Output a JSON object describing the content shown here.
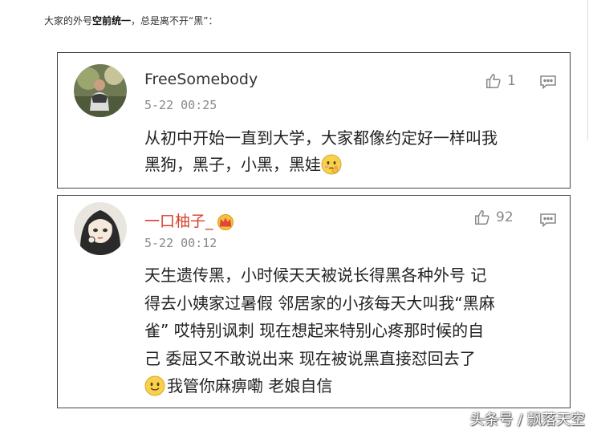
{
  "intro": {
    "prefix": "大家的外号",
    "bold": "空前统一",
    "suffix": "，总是离不开“黑”："
  },
  "comments": [
    {
      "username": "FreeSomebody",
      "time": "5-22 00:25",
      "likes": "1",
      "lines": [
        "从初中开始一直到大学，大家都像约定好一样叫我",
        "黑狗，黑子，小黑，黑娃"
      ],
      "emoji_icon": "shy-face-emoji"
    },
    {
      "username": "一口柚子_",
      "time": "5-22 00:12",
      "likes": "92",
      "badge_icon": "crown-badge-icon",
      "lines": [
        "天生遗传黑，小时候天天被说长得黑各种外号 记",
        "得去小姨家过暑假 邻居家的小孩每天大叫我“黑麻",
        "雀” 哎特别讽刺 现在想起来特别心疼那时候的自",
        "己 委屈又不敢说出来 现在被说黑直接怼回去了",
        "我管你麻痹嘞 老娘自信"
      ],
      "emoji_icon": "smile-face-emoji"
    }
  ],
  "watermark": "头条号 / 飘落天空"
}
